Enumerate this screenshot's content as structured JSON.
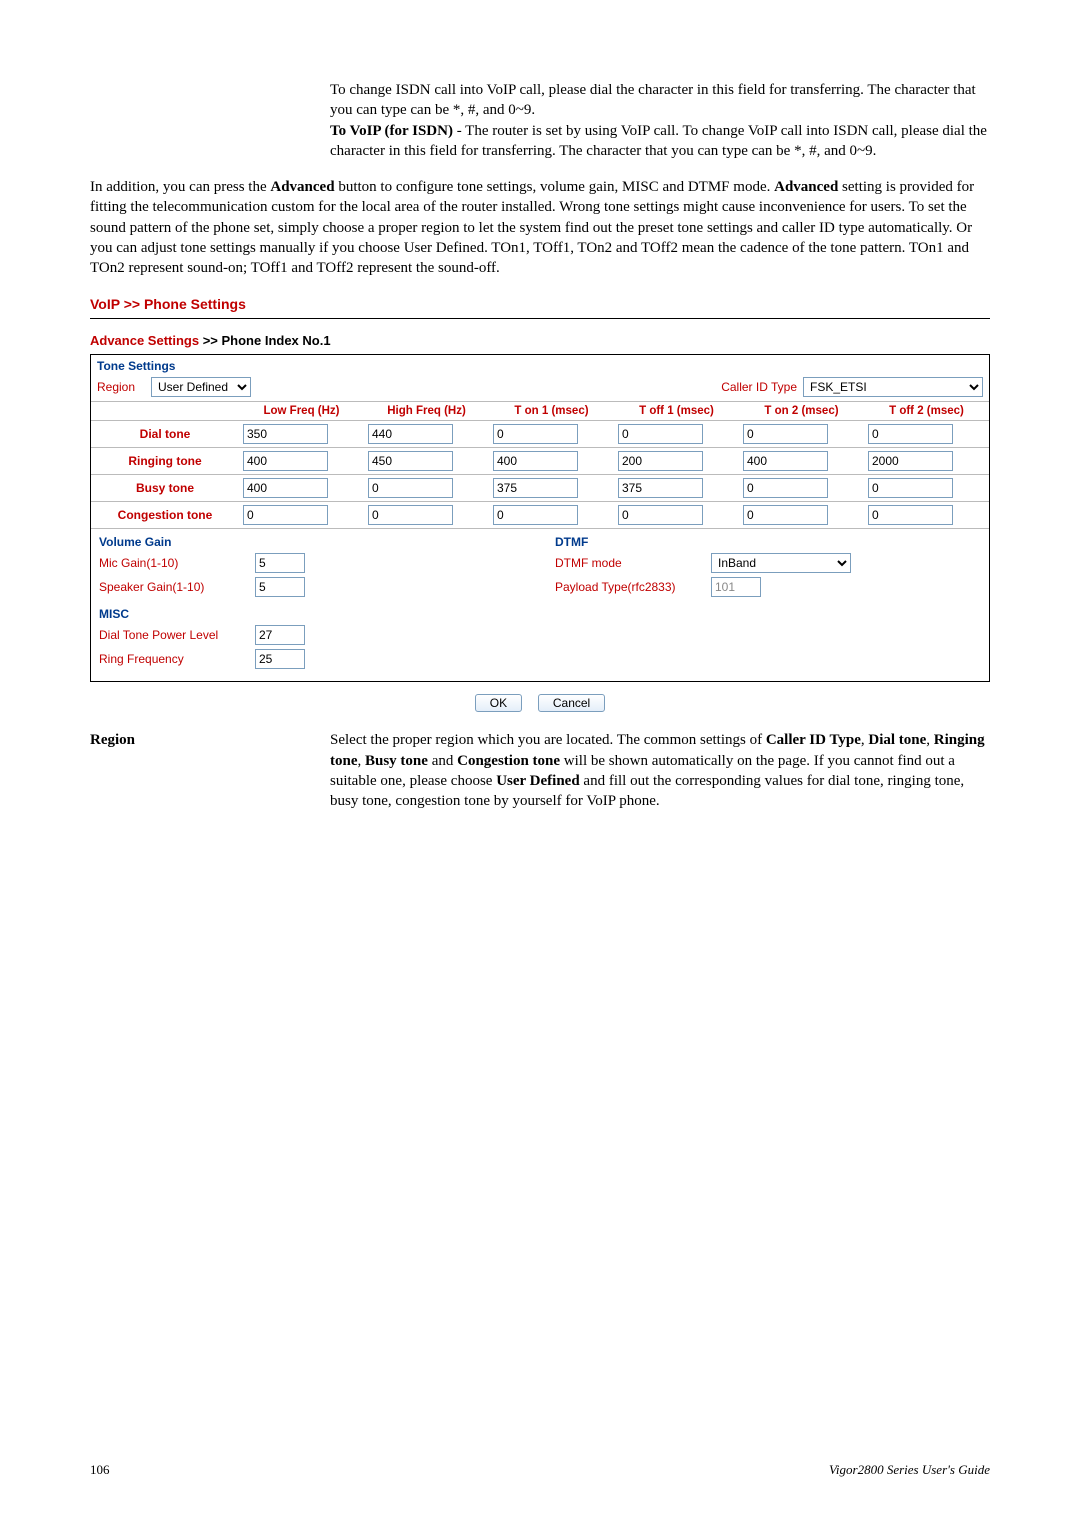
{
  "intro": {
    "p1a": "To change ISDN call into VoIP call, please dial the character in this field for transferring. The character that you can type can be *, #, and 0~9.",
    "p1b_bold": "To VoIP (for ISDN)",
    "p1b_rest": " - The router is set by using VoIP call. To change VoIP call into ISDN call, please dial the character in this field for transferring. The character that you can type can be *, #, and 0~9."
  },
  "body": {
    "p2_a": "In addition, you can press the ",
    "p2_b": "Advanced",
    "p2_c": " button to configure tone settings, volume gain, MISC and DTMF mode. ",
    "p2_d": "Advanced",
    "p2_e": " setting is provided for fitting the telecommunication custom for the local area of the router installed. Wrong tone settings might cause inconvenience for users. To set the sound pattern of the phone set, simply choose a proper region to let the system find out the preset tone settings and caller ID type automatically. Or you can adjust tone settings manually if you choose User Defined. TOn1, TOff1, TOn2 and TOff2 mean the cadence of the tone pattern. TOn1 and TOn2 represent sound-on; TOff1 and TOff2 represent the sound-off."
  },
  "ui": {
    "page_title": "VoIP >> Phone Settings",
    "adv_title_a": "Advance Settings ",
    "adv_title_b": ">> Phone Index No.1",
    "tone_settings_label": "Tone Settings",
    "region_label": "Region",
    "region_value": "User Defined",
    "caller_id_label": "Caller ID Type",
    "caller_id_value": "FSK_ETSI",
    "headers": {
      "low": "Low Freq (Hz)",
      "high": "High Freq (Hz)",
      "ton1": "T on 1 (msec)",
      "toff1": "T off 1 (msec)",
      "ton2": "T on 2 (msec)",
      "toff2": "T off 2 (msec)"
    },
    "rows": [
      {
        "name": "Dial tone",
        "v": [
          "350",
          "440",
          "0",
          "0",
          "0",
          "0"
        ]
      },
      {
        "name": "Ringing tone",
        "v": [
          "400",
          "450",
          "400",
          "200",
          "400",
          "2000"
        ]
      },
      {
        "name": "Busy tone",
        "v": [
          "400",
          "0",
          "375",
          "375",
          "0",
          "0"
        ]
      },
      {
        "name": "Congestion tone",
        "v": [
          "0",
          "0",
          "0",
          "0",
          "0",
          "0"
        ]
      }
    ],
    "volume_gain_label": "Volume Gain",
    "mic_gain_label": "Mic Gain(1-10)",
    "mic_gain_value": "5",
    "speaker_gain_label": "Speaker Gain(1-10)",
    "speaker_gain_value": "5",
    "dtmf_label": "DTMF",
    "dtmf_mode_label": "DTMF mode",
    "dtmf_mode_value": "InBand",
    "payload_label": "Payload Type(rfc2833)",
    "payload_value": "101",
    "misc_label": "MISC",
    "dial_tone_power_label": "Dial Tone Power Level",
    "dial_tone_power_value": "27",
    "ring_freq_label": "Ring Frequency",
    "ring_freq_value": "25",
    "ok": "OK",
    "cancel": "Cancel"
  },
  "region_term": {
    "term": "Region",
    "def_a": "Select the proper region which you are located. The common settings of ",
    "def_b": "Caller ID Type",
    "def_c": ", ",
    "def_d": "Dial tone",
    "def_e": ", ",
    "def_f": "Ringing tone",
    "def_g": ", ",
    "def_h": "Busy tone",
    "def_i": " and ",
    "def_j": "Congestion tone",
    "def_k": " will be shown automatically on the page. If you cannot find out a suitable one, please choose ",
    "def_l": "User Defined",
    "def_m": " and fill out the corresponding values for dial tone, ringing tone, busy tone, congestion tone by yourself for VoIP phone."
  },
  "footer": {
    "page": "106",
    "guide": "Vigor2800 Series User's Guide"
  }
}
